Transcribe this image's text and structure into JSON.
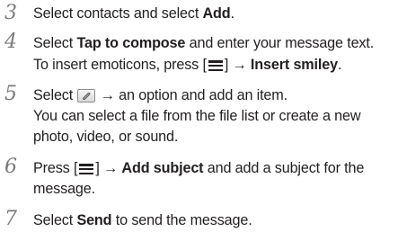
{
  "steps": [
    {
      "number": "3",
      "lines": [
        {
          "t1": "Select contacts and select ",
          "b1": "Add",
          "t2": "."
        }
      ]
    },
    {
      "number": "4",
      "lines": [
        {
          "t1": "Select ",
          "b1": "Tap to compose",
          "t2": " and enter your message text."
        },
        {
          "t1": "To insert emoticons, press [",
          "t2": "] → ",
          "b1": "Insert smiley",
          "t3": "."
        }
      ]
    },
    {
      "number": "5",
      "lines": [
        {
          "t1": "Select ",
          "t2": " → an option and add an item."
        },
        {
          "t1": "You can select a file from the file list or create a new"
        },
        {
          "t1": "photo, video, or sound."
        }
      ]
    },
    {
      "number": "6",
      "lines": [
        {
          "t1": "Press [",
          "t2": "] → ",
          "b1": "Add subject",
          "t3": " and add a subject for the"
        },
        {
          "t1": "message."
        }
      ]
    },
    {
      "number": "7",
      "lines": [
        {
          "t1": "Select ",
          "b1": "Send",
          "t2": " to send the message."
        }
      ]
    }
  ],
  "icons": {
    "menu_key": "menu-key-icon",
    "attach_key": "paperclip-icon"
  }
}
